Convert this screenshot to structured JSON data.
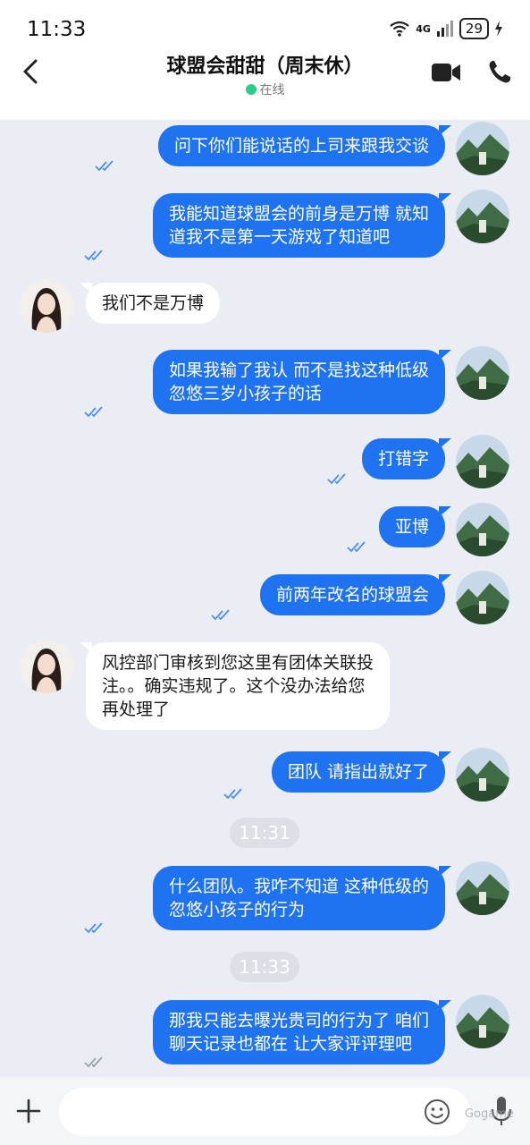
{
  "status_bar": {
    "time": "11:33",
    "network": "4G",
    "battery": "29"
  },
  "header": {
    "title": "球盟会甜甜（周末休）",
    "status": "在线"
  },
  "messages": [
    {
      "dir": "out",
      "lines": [
        "问下你们能说话的上司来跟我交谈"
      ]
    },
    {
      "dir": "out",
      "lines": [
        "我能知道球盟会的前身是万博 就知",
        "道我不是第一天游戏了知道吧"
      ]
    },
    {
      "dir": "in",
      "lines": [
        "我们不是万博"
      ]
    },
    {
      "dir": "out",
      "lines": [
        "如果我输了我认 而不是找这种低级",
        "忽悠三岁小孩子的话"
      ]
    },
    {
      "dir": "out",
      "lines": [
        "打错字"
      ]
    },
    {
      "dir": "out",
      "lines": [
        "亚博"
      ]
    },
    {
      "dir": "out",
      "lines": [
        "前两年改名的球盟会"
      ]
    },
    {
      "dir": "in",
      "lines": [
        "风控部门审核到您这里有团体关联投",
        "注。。确实违规了。这个没办法给您",
        "再处理了"
      ]
    },
    {
      "dir": "out",
      "lines": [
        "团队 请指出就好了"
      ]
    },
    {
      "dir": "out",
      "lines": [
        "什么团队。我咋不知道 这种低级的",
        "忽悠小孩子的行为"
      ]
    },
    {
      "dir": "out",
      "lines": [
        "那我只能去曝光贵司的行为了 咱们",
        "聊天记录也都在 让大家评评理吧"
      ]
    }
  ],
  "timestamps": [
    "11:31",
    "11:33"
  ],
  "input": {
    "placeholder": ""
  },
  "watermark": "Gogame",
  "icons": {
    "back": "back-arrow-icon",
    "video": "video-camera-icon",
    "phone": "phone-icon",
    "plus": "plus-icon",
    "emoji": "emoji-icon",
    "mic": "microphone-icon",
    "read": "double-check-icon"
  },
  "colors": {
    "outgoing_bubble": "#1f73f1",
    "incoming_bubble": "#ffffff",
    "background": "#eaedf3",
    "online_dot": "#2ccc8a",
    "read_tick": "#4a8ef5",
    "sent_tick": "#9aa0a8"
  }
}
